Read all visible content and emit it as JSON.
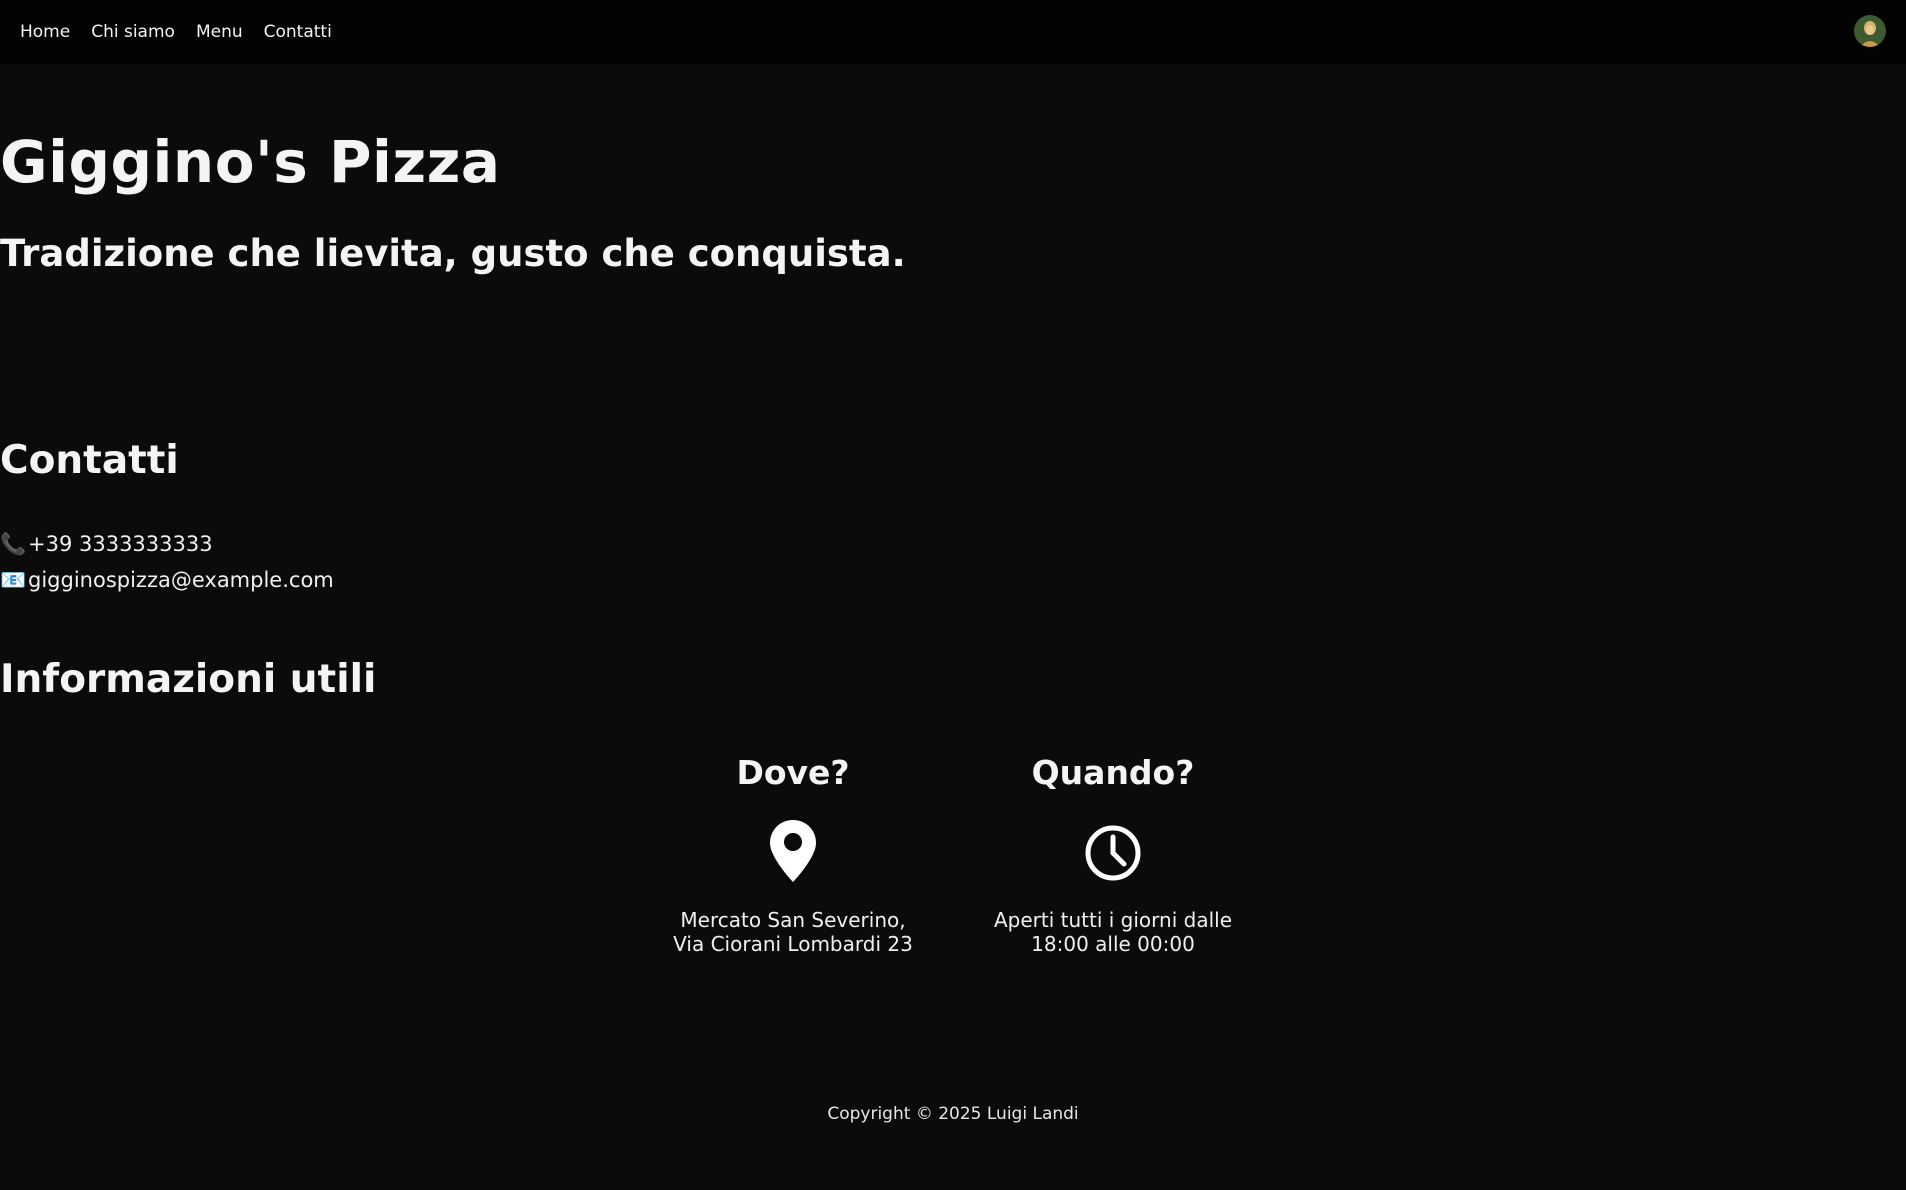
{
  "nav": {
    "items": [
      {
        "label": "Home"
      },
      {
        "label": "Chi siamo"
      },
      {
        "label": "Menu"
      },
      {
        "label": "Contatti"
      }
    ],
    "avatar_icon": "user-avatar"
  },
  "hero": {
    "title": "Giggino's Pizza",
    "tagline": "Tradizione che lievita, gusto che conquista."
  },
  "contacts": {
    "heading": "Contatti",
    "phone_icon": "📞",
    "phone": "+39 3333333333",
    "email_icon": "📧",
    "email": "gigginospizza@example.com"
  },
  "info": {
    "heading": "Informazioni utili",
    "where": {
      "title": "Dove?",
      "icon": "map-pin-icon",
      "line1": "Mercato San Severino,",
      "line2": "Via Ciorani Lombardi 23"
    },
    "when": {
      "title": "Quando?",
      "icon": "clock-icon",
      "line1": "Aperti tutti i giorni dalle",
      "line2": "18:00 alle 00:00"
    }
  },
  "footer": {
    "copyright": "Copyright © 2025 Luigi Landi"
  },
  "colors": {
    "background": "#0b0b0b",
    "navbar": "#030303",
    "text": "#ffffff"
  }
}
